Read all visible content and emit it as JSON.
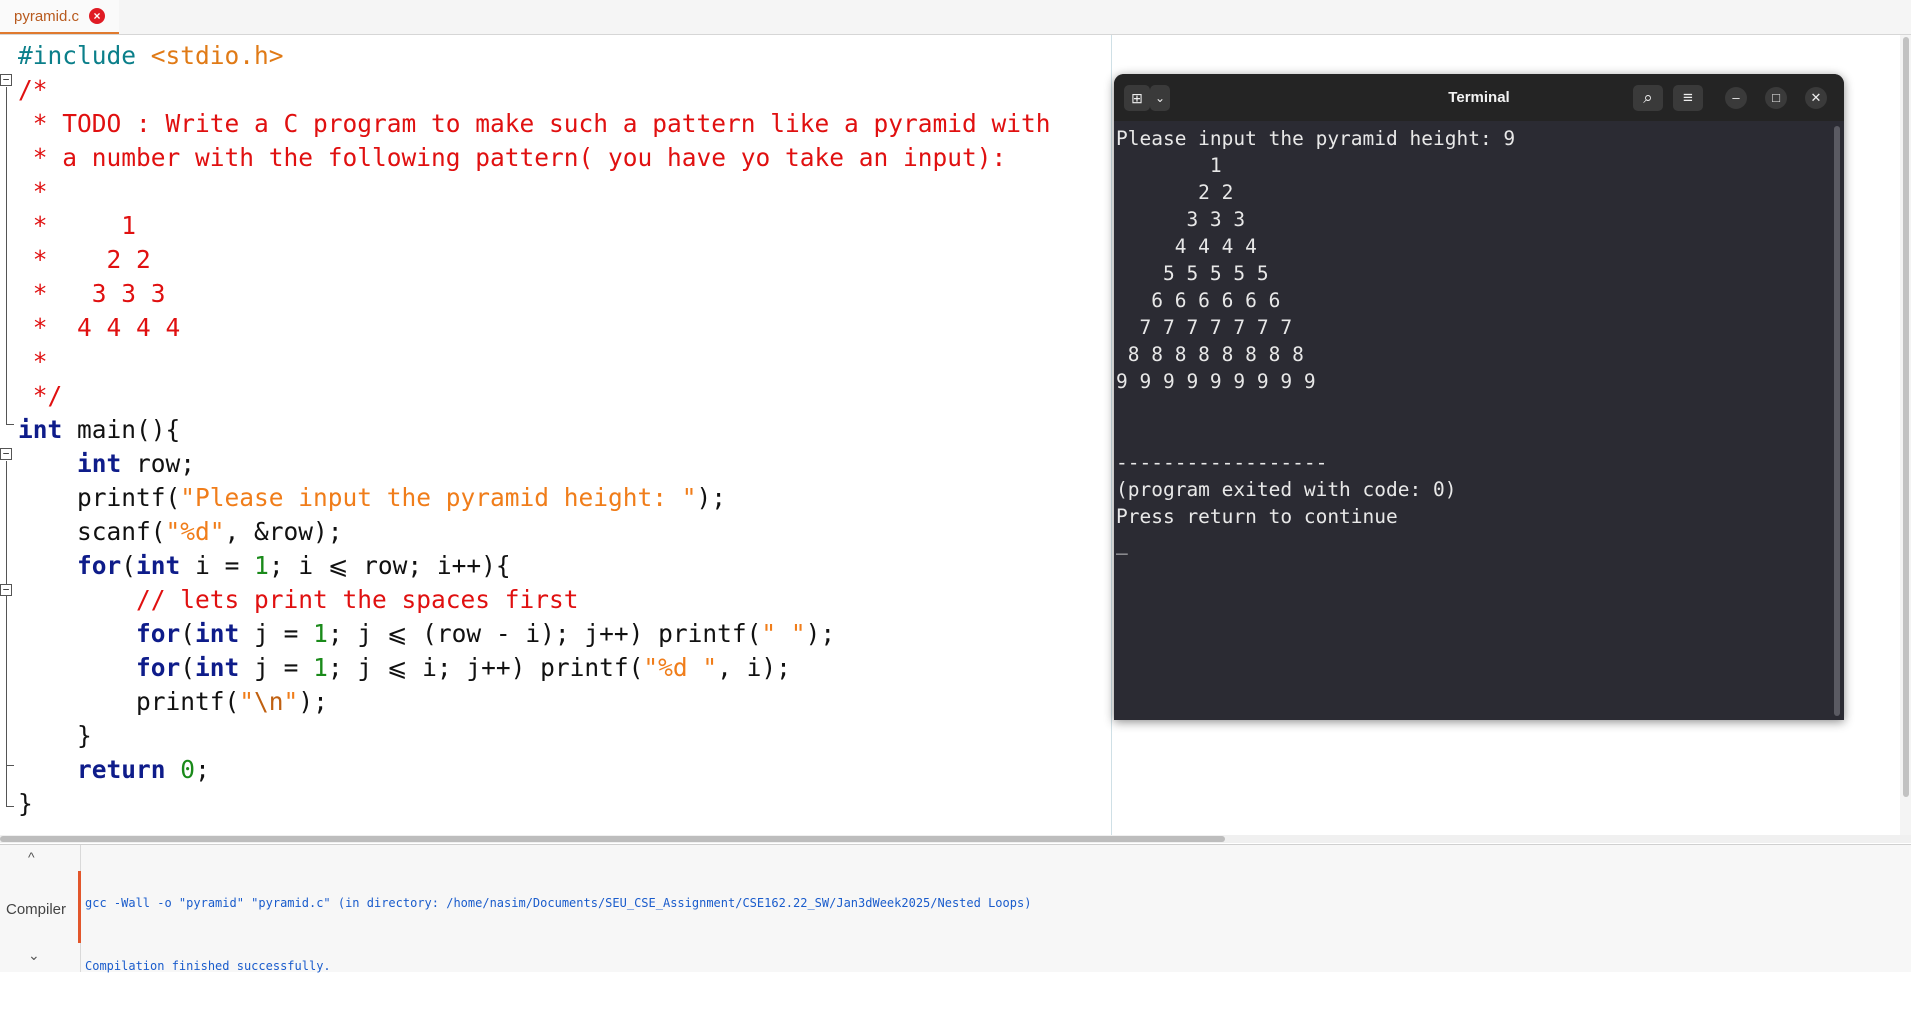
{
  "tab": {
    "filename": "pyramid.c",
    "close_icon": "×"
  },
  "code_lines": [
    [
      {
        "t": "#include ",
        "c": "pp"
      },
      {
        "t": "<stdio.h>",
        "c": "hdr"
      }
    ],
    [
      {
        "t": "/*",
        "c": "cm"
      }
    ],
    [
      {
        "t": " * TODO : Write a C program to make such a pattern like a pyramid with",
        "c": "cm"
      }
    ],
    [
      {
        "t": " * a number with the following pattern( you have yo take an input):",
        "c": "cm"
      }
    ],
    [
      {
        "t": " *",
        "c": "cm"
      }
    ],
    [
      {
        "t": " *     1",
        "c": "cm"
      }
    ],
    [
      {
        "t": " *    2 2",
        "c": "cm"
      }
    ],
    [
      {
        "t": " *   3 3 3",
        "c": "cm"
      }
    ],
    [
      {
        "t": " *  4 4 4 4",
        "c": "cm"
      }
    ],
    [
      {
        "t": " *",
        "c": "cm"
      }
    ],
    [
      {
        "t": " */",
        "c": "cm"
      }
    ],
    [
      {
        "t": "int",
        "c": "kw"
      },
      {
        "t": " main(){",
        "c": ""
      }
    ],
    [
      {
        "t": "    ",
        "c": ""
      },
      {
        "t": "int",
        "c": "kw"
      },
      {
        "t": " row;",
        "c": ""
      }
    ],
    [
      {
        "t": "    printf(",
        "c": ""
      },
      {
        "t": "\"Please input the pyramid height: \"",
        "c": "str"
      },
      {
        "t": ");",
        "c": ""
      }
    ],
    [
      {
        "t": "    scanf(",
        "c": ""
      },
      {
        "t": "\"%d\"",
        "c": "str"
      },
      {
        "t": ", &row);",
        "c": ""
      }
    ],
    [
      {
        "t": "    ",
        "c": ""
      },
      {
        "t": "for",
        "c": "kw"
      },
      {
        "t": "(",
        "c": ""
      },
      {
        "t": "int",
        "c": "kw"
      },
      {
        "t": " i = ",
        "c": ""
      },
      {
        "t": "1",
        "c": "num"
      },
      {
        "t": "; i ⩽ row; i++){",
        "c": ""
      }
    ],
    [
      {
        "t": "        // lets print the spaces first",
        "c": "cm"
      }
    ],
    [
      {
        "t": "        ",
        "c": ""
      },
      {
        "t": "for",
        "c": "kw"
      },
      {
        "t": "(",
        "c": ""
      },
      {
        "t": "int",
        "c": "kw"
      },
      {
        "t": " j = ",
        "c": ""
      },
      {
        "t": "1",
        "c": "num"
      },
      {
        "t": "; j ⩽ (row - i); j++) printf(",
        "c": ""
      },
      {
        "t": "\" \"",
        "c": "str"
      },
      {
        "t": ");",
        "c": ""
      }
    ],
    [
      {
        "t": "        ",
        "c": ""
      },
      {
        "t": "for",
        "c": "kw"
      },
      {
        "t": "(",
        "c": ""
      },
      {
        "t": "int",
        "c": "kw"
      },
      {
        "t": " j = ",
        "c": ""
      },
      {
        "t": "1",
        "c": "num"
      },
      {
        "t": "; j ⩽ i; j++) printf(",
        "c": ""
      },
      {
        "t": "\"%d \"",
        "c": "str"
      },
      {
        "t": ", i);",
        "c": ""
      }
    ],
    [
      {
        "t": "        printf(",
        "c": ""
      },
      {
        "t": "\"",
        "c": "str"
      },
      {
        "t": "\\n",
        "c": "esc"
      },
      {
        "t": "\"",
        "c": "str"
      },
      {
        "t": ");",
        "c": ""
      }
    ],
    [
      {
        "t": "    }",
        "c": ""
      }
    ],
    [
      {
        "t": "    ",
        "c": ""
      },
      {
        "t": "return",
        "c": "kw"
      },
      {
        "t": " ",
        "c": ""
      },
      {
        "t": "0",
        "c": "num"
      },
      {
        "t": ";",
        "c": ""
      }
    ],
    [
      {
        "t": "}",
        "c": ""
      }
    ]
  ],
  "terminal": {
    "title": "Terminal",
    "new_tab_icon": "⊞",
    "dropdown_icon": "⌄",
    "search_icon": "⌕",
    "menu_icon": "≡",
    "minimize_icon": "–",
    "maximize_icon": "□",
    "close_icon": "✕",
    "lines": [
      "Please input the pyramid height: 9",
      "        1",
      "       2 2",
      "      3 3 3",
      "     4 4 4 4",
      "    5 5 5 5 5",
      "   6 6 6 6 6 6",
      "  7 7 7 7 7 7 7",
      " 8 8 8 8 8 8 8 8",
      "9 9 9 9 9 9 9 9 9",
      "",
      "",
      "------------------",
      "(program exited with code: 0)",
      "Press return to continue",
      "_"
    ]
  },
  "compiler_panel": {
    "label": "Compiler",
    "up_icon": "^",
    "down_icon": "⌄",
    "log_lines": [
      "gcc -Wall -o \"pyramid\" \"pyramid.c\" (in directory: /home/nasim/Documents/SEU_CSE_Assignment/CSE162.22_SW/Jan3dWeek2025/Nested Loops)",
      "Compilation finished successfully."
    ]
  }
}
